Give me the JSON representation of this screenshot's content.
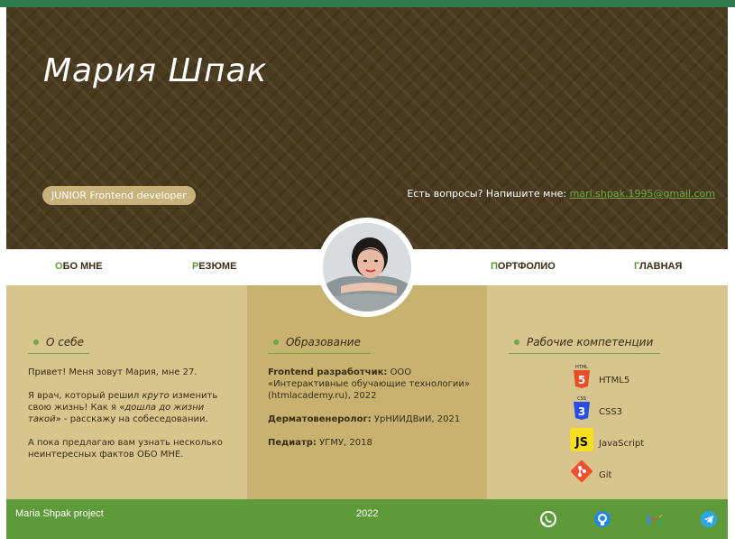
{
  "header": {
    "name": "Мария Шпак",
    "badge": "JUNIOR Frontend developer",
    "contact_text": "Есть вопросы? Напишите мне: ",
    "contact_email": "mari.shpak.1995@gmail.com"
  },
  "nav": {
    "items": [
      {
        "first": "О",
        "rest": "бо мне"
      },
      {
        "first": "Р",
        "rest": "езюме"
      },
      {
        "first": "П",
        "rest": "ортфолио"
      },
      {
        "first": "Г",
        "rest": "лавная"
      }
    ]
  },
  "about": {
    "title": "О себе",
    "p1": "Привет! Меня зовут Мария, мне 27.",
    "p2a": "Я врач, который решил ",
    "p2_em1": "круто",
    "p2b": " изменить свою жизнь! Как я «",
    "p2_em2": "дошла до жизни такой",
    "p2c": "» - расскажу на собеседовании.",
    "p3": "А пока предлагаю вам узнать несколько неинтересных фактов ОБО МНЕ."
  },
  "education": {
    "title": "Образование",
    "items": [
      {
        "role": "Frontend разработчик:",
        "place": "ООО «Интерактивные обучающие технологии» (htmlacademy.ru), 2022"
      },
      {
        "role": "Дерматовенеролог:",
        "place": "УрНИИДВиИ, 2021"
      },
      {
        "role": "Педиатр:",
        "place": "УГМУ, 2018"
      }
    ]
  },
  "skills": {
    "title": "Рабочие компетенции",
    "items": [
      {
        "label": "HTML5",
        "icon": "html5-icon",
        "color": "#e44d26"
      },
      {
        "label": "CSS3",
        "icon": "css3-icon",
        "color": "#264de4"
      },
      {
        "label": "JavaScript",
        "icon": "javascript-icon",
        "color": "#f7df1e"
      },
      {
        "label": "Git",
        "icon": "git-icon",
        "color": "#f05133"
      }
    ]
  },
  "footer": {
    "project": "Maria Shpak project",
    "year": "2022",
    "social": [
      "whatsapp-icon",
      "github-icon",
      "gmail-icon",
      "telegram-icon"
    ]
  },
  "colors": {
    "accent_green": "#5f9a3a",
    "hero_brown": "#4a3b1f",
    "sand": "#d8c48d",
    "sand_dark": "#c8b26f"
  }
}
